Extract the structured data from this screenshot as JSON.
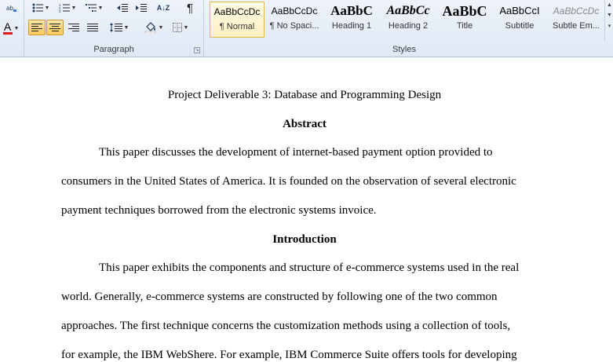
{
  "ribbon": {
    "paragraph_label": "Paragraph",
    "styles_label": "Styles",
    "pilcrow": "¶",
    "sort_glyph": "A↓Z",
    "font_color_glyph": "A"
  },
  "styles": [
    {
      "sample": "AaBbCcDc",
      "name": "¶ Normal"
    },
    {
      "sample": "AaBbCcDc",
      "name": "¶ No Spaci..."
    },
    {
      "sample": "AaBbC",
      "name": "Heading 1"
    },
    {
      "sample": "AaBbCc",
      "name": "Heading 2"
    },
    {
      "sample": "AaBbC",
      "name": "Title"
    },
    {
      "sample": "AaBbCcI",
      "name": "Subtitle"
    },
    {
      "sample": "AaBbCcDc",
      "name": "Subtle Em..."
    }
  ],
  "document": {
    "title": "Project Deliverable 3: Database and Programming Design",
    "abstract_heading": "Abstract",
    "abstract_lines": [
      "This paper discusses the development of internet-based payment option provided to",
      "consumers in the United States of America. It is founded on the observation of several electronic",
      "payment techniques borrowed from the electronic systems invoice."
    ],
    "intro_heading": "Introduction",
    "intro_lines": [
      "This paper exhibits the components and structure of e-commerce systems used in the real",
      "world. Generally, e-commerce systems are constructed by following one of the two common",
      "approaches. The first technique concerns the customization methods using a collection of tools,",
      "for example, the IBM WebShere. For example, IBM Commerce Suite offers tools for developing"
    ]
  }
}
